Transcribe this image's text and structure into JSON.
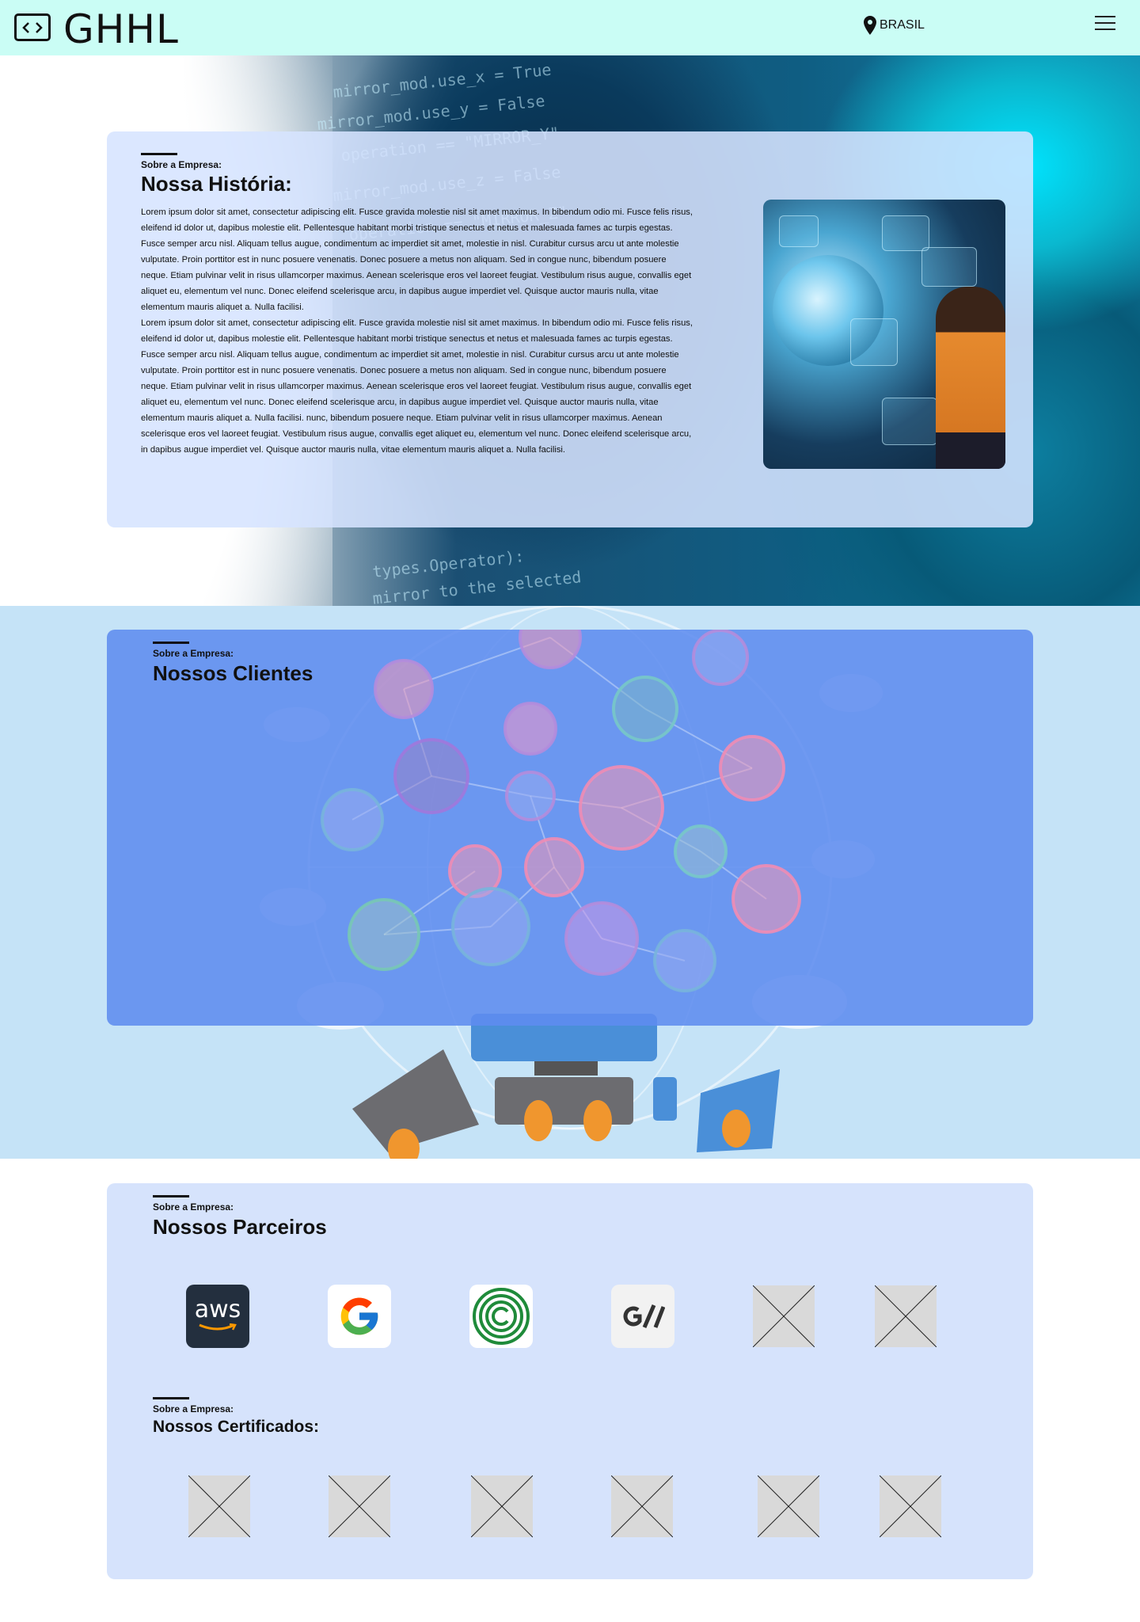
{
  "header": {
    "brand": "GHHL",
    "location_label": "BRASIL"
  },
  "history": {
    "eyebrow": "Sobre a Empresa:",
    "title": "Nossa História:",
    "paragraph_1": "Lorem ipsum dolor sit amet, consectetur adipiscing elit. Fusce gravida molestie nisl sit amet maximus. In bibendum odio mi. Fusce felis risus, eleifend id dolor ut, dapibus molestie elit. Pellentesque habitant morbi tristique senectus et netus et malesuada fames ac turpis egestas. Fusce semper arcu nisl. Aliquam tellus augue, condimentum ac imperdiet sit amet, molestie in nisl. Curabitur cursus arcu ut ante molestie vulputate. Proin porttitor est in nunc posuere venenatis. Donec posuere a metus non aliquam. Sed in congue nunc, bibendum posuere neque. Etiam pulvinar velit in risus ullamcorper maximus. Aenean scelerisque eros vel laoreet feugiat. Vestibulum risus augue, convallis eget aliquet eu, elementum vel nunc. Donec eleifend scelerisque arcu, in dapibus augue imperdiet vel. Quisque auctor mauris nulla, vitae elementum mauris aliquet a. Nulla facilisi.",
    "paragraph_2": "Lorem ipsum dolor sit amet, consectetur adipiscing elit. Fusce gravida molestie nisl sit amet maximus. In bibendum odio mi. Fusce felis risus, eleifend id dolor ut, dapibus molestie elit. Pellentesque habitant morbi tristique senectus et netus et malesuada fames ac turpis egestas. Fusce semper arcu nisl. Aliquam tellus augue, condimentum ac imperdiet sit amet, molestie in nisl. Curabitur cursus arcu ut ante molestie vulputate. Proin porttitor est in nunc posuere venenatis. Donec posuere a metus non aliquam. Sed in congue nunc, bibendum posuere neque. Etiam pulvinar velit in risus ullamcorper maximus. Aenean scelerisque eros vel laoreet feugiat. Vestibulum risus augue, convallis eget aliquet eu, elementum vel nunc. Donec eleifend scelerisque arcu, in dapibus augue imperdiet vel. Quisque auctor mauris nulla, vitae elementum mauris aliquet a. Nulla facilisi. nunc, bibendum posuere neque. Etiam pulvinar velit in risus ullamcorper maximus. Aenean scelerisque eros vel laoreet feugiat. Vestibulum risus augue, convallis eget aliquet eu, elementum vel nunc. Donec eleifend scelerisque arcu, in dapibus augue imperdiet vel. Quisque auctor mauris nulla, vitae elementum mauris aliquet a. Nulla facilisi."
  },
  "clients": {
    "eyebrow": "Sobre a Empresa:",
    "title": "Nossos Clientes"
  },
  "partners": {
    "eyebrow": "Sobre a Empresa:",
    "title": "Nossos Parceiros",
    "logos": [
      "aws-logo",
      "google-logo",
      "copyright-logo",
      "g2-logo",
      "placeholder-image",
      "placeholder-image"
    ],
    "aws_text": "aws"
  },
  "certificates": {
    "eyebrow": "Sobre a Empresa:",
    "title": "Nossos Certificados:"
  },
  "colors": {
    "header_bg": "#cafdf5",
    "history_card": "#d6e4ff",
    "clients_card": "#5e8cef",
    "clients_bg": "#c5e3f7",
    "partners_card": "#d6e3fc"
  }
}
